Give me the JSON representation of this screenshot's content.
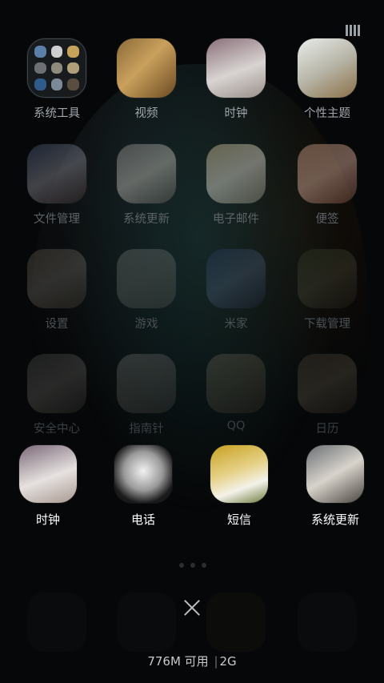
{
  "status": {
    "icon": "bars-icon"
  },
  "apps": [
    {
      "id": "tools",
      "label": "系统工具",
      "folder": true
    },
    {
      "id": "video",
      "label": "视频"
    },
    {
      "id": "clock",
      "label": "时钟"
    },
    {
      "id": "theme",
      "label": "个性主题"
    },
    {
      "id": "files",
      "label": "文件管理"
    },
    {
      "id": "updater",
      "label": "系统更新"
    },
    {
      "id": "email",
      "label": "电子邮件"
    },
    {
      "id": "notes",
      "label": "便签"
    },
    {
      "id": "settings",
      "label": "设置"
    },
    {
      "id": "games",
      "label": "游戏"
    },
    {
      "id": "mihome",
      "label": "米家"
    },
    {
      "id": "downloads",
      "label": "下载管理"
    },
    {
      "id": "security",
      "label": "安全中心"
    },
    {
      "id": "compass",
      "label": "指南针"
    },
    {
      "id": "qq",
      "label": "QQ"
    },
    {
      "id": "calendar",
      "label": "日历"
    }
  ],
  "dock": [
    {
      "id": "clock",
      "label": "时钟"
    },
    {
      "id": "phone",
      "label": "电话"
    },
    {
      "id": "sms",
      "label": "短信"
    },
    {
      "id": "updater",
      "label": "系统更新"
    }
  ],
  "recents": {
    "close_icon": "close-icon",
    "memory": "776M 可用",
    "separator": "|",
    "network": "2G"
  },
  "colors": {
    "background": "#060708",
    "label_text": "#9ea5ab",
    "dock_text": "#ffffff"
  }
}
